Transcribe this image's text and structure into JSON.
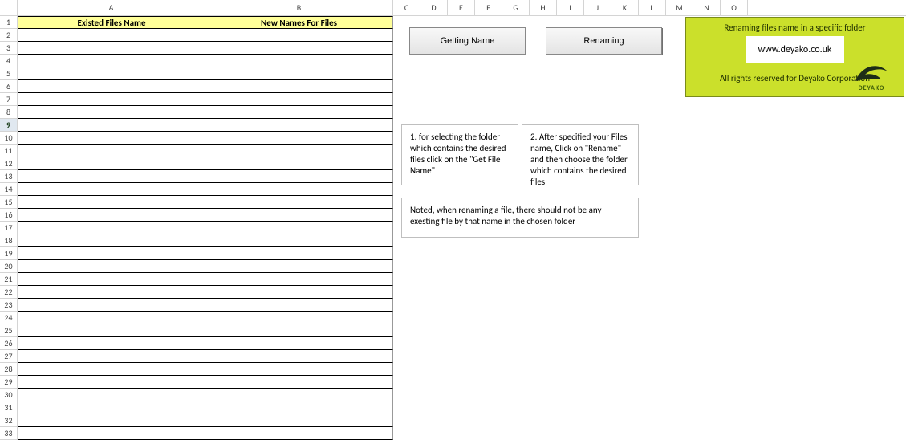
{
  "columns": [
    "A",
    "B",
    "C",
    "D",
    "E",
    "F",
    "G",
    "H",
    "I",
    "J",
    "K",
    "L",
    "M",
    "N",
    "O"
  ],
  "row_count": 33,
  "selected_row": 9,
  "table": {
    "headers": {
      "colA": "Existed Files Name",
      "colB": "New Names For Files"
    }
  },
  "buttons": {
    "getting_name": "Getting Name",
    "renaming": "Renaming"
  },
  "panel": {
    "title": "Renaming files name in a specific folder",
    "url": "www.deyako.co.uk",
    "rights": "All rights reserved for Deyako Corporation",
    "logo_name": "DEYAKO"
  },
  "notes": {
    "step1": "1. for selecting the folder which contains the desired files click on the \"Get File Name\"",
    "step2": "2. After specified your Files name, Click on \"Rename\" and then choose the folder which contains the desired files",
    "warning": "Noted, when renaming a file, there should not be any exesting file by that name in the chosen folder"
  },
  "colors": {
    "panel_bg": "#cbe02b",
    "header_bg": "#ffff99"
  }
}
